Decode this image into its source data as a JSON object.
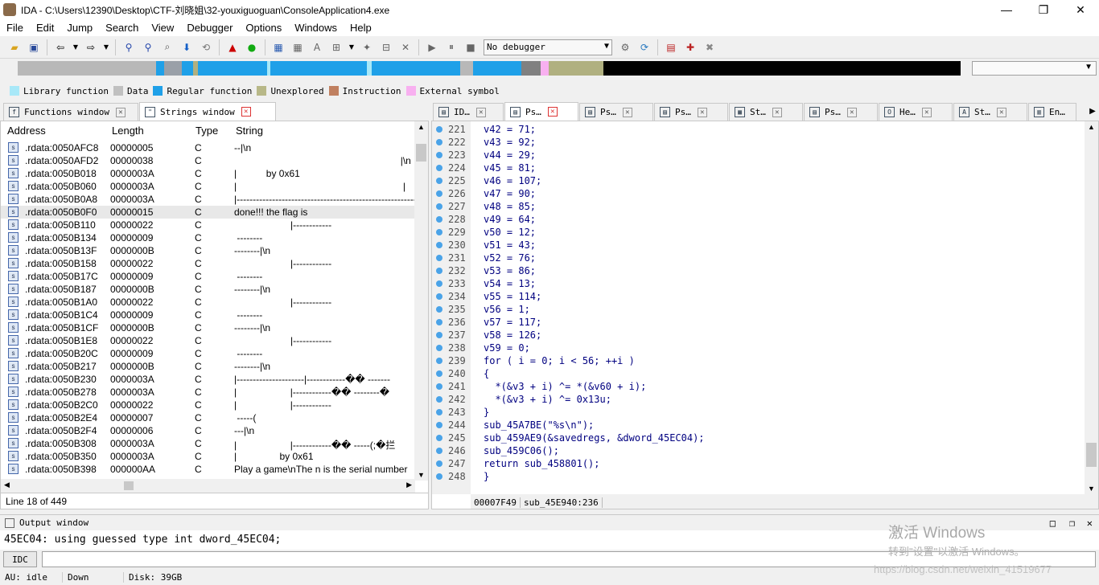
{
  "window": {
    "title": "IDA - C:\\Users\\12390\\Desktop\\CTF-刘晓姐\\32-youxiguoguan\\ConsoleApplication4.exe",
    "minimize": "—",
    "restore": "❐",
    "close": "✕"
  },
  "menu": [
    "File",
    "Edit",
    "Jump",
    "Search",
    "View",
    "Debugger",
    "Options",
    "Windows",
    "Help"
  ],
  "toolbar": {
    "debugger_select": "No debugger"
  },
  "legend": [
    {
      "label": "Library function",
      "color": "#a8e8f8"
    },
    {
      "label": "Data",
      "color": "#c0c0c0"
    },
    {
      "label": "Regular function",
      "color": "#1fa0e8"
    },
    {
      "label": "Unexplored",
      "color": "#b8b888"
    },
    {
      "label": "Instruction",
      "color": "#c08060"
    },
    {
      "label": "External symbol",
      "color": "#f8b0f0"
    }
  ],
  "left_tabs": [
    {
      "label": "Functions window",
      "icon": "f",
      "active": false
    },
    {
      "label": "Strings window",
      "icon": "\"",
      "active": true
    }
  ],
  "right_tabs": [
    {
      "label": "ID…",
      "active": false
    },
    {
      "label": "Ps…",
      "active": true
    },
    {
      "label": "Ps…",
      "active": false
    },
    {
      "label": "Ps…",
      "active": false
    },
    {
      "label": "St…",
      "active": false
    },
    {
      "label": "Ps…",
      "active": false
    },
    {
      "label": "He…",
      "active": false
    },
    {
      "label": "St…",
      "active": false
    },
    {
      "label": "En…",
      "active": false
    }
  ],
  "strings": {
    "columns": [
      "Address",
      "Length",
      "Type",
      "String"
    ],
    "rows": [
      {
        "addr": ".rdata:0050AFC8",
        "len": "00000005",
        "type": "C",
        "str": "--|\\n"
      },
      {
        "addr": ".rdata:0050AFD2",
        "len": "00000038",
        "type": "C",
        "str": "                                                              |\\n"
      },
      {
        "addr": ".rdata:0050B018",
        "len": "0000003A",
        "type": "C",
        "str": "|           by 0x61"
      },
      {
        "addr": ".rdata:0050B060",
        "len": "0000003A",
        "type": "C",
        "str": "|                                                              |"
      },
      {
        "addr": ".rdata:0050B0A8",
        "len": "0000003A",
        "type": "C",
        "str": "|-----------------------------------------------------------"
      },
      {
        "addr": ".rdata:0050B0F0",
        "len": "00000015",
        "type": "C",
        "str": "done!!! the flag is ",
        "selected": true
      },
      {
        "addr": ".rdata:0050B110",
        "len": "00000022",
        "type": "C",
        "str": "                     |------------"
      },
      {
        "addr": ".rdata:0050B134",
        "len": "00000009",
        "type": "C",
        "str": " --------"
      },
      {
        "addr": ".rdata:0050B13F",
        "len": "0000000B",
        "type": "C",
        "str": "--------|\\n"
      },
      {
        "addr": ".rdata:0050B158",
        "len": "00000022",
        "type": "C",
        "str": "                     |------------"
      },
      {
        "addr": ".rdata:0050B17C",
        "len": "00000009",
        "type": "C",
        "str": " --------"
      },
      {
        "addr": ".rdata:0050B187",
        "len": "0000000B",
        "type": "C",
        "str": "--------|\\n"
      },
      {
        "addr": ".rdata:0050B1A0",
        "len": "00000022",
        "type": "C",
        "str": "                     |------------"
      },
      {
        "addr": ".rdata:0050B1C4",
        "len": "00000009",
        "type": "C",
        "str": " --------"
      },
      {
        "addr": ".rdata:0050B1CF",
        "len": "0000000B",
        "type": "C",
        "str": "--------|\\n"
      },
      {
        "addr": ".rdata:0050B1E8",
        "len": "00000022",
        "type": "C",
        "str": "                     |------------"
      },
      {
        "addr": ".rdata:0050B20C",
        "len": "00000009",
        "type": "C",
        "str": " --------"
      },
      {
        "addr": ".rdata:0050B217",
        "len": "0000000B",
        "type": "C",
        "str": "--------|\\n"
      },
      {
        "addr": ".rdata:0050B230",
        "len": "0000003A",
        "type": "C",
        "str": "|---------------------|------------�� -------"
      },
      {
        "addr": ".rdata:0050B278",
        "len": "0000003A",
        "type": "C",
        "str": "|                    |------------�� --------�"
      },
      {
        "addr": ".rdata:0050B2C0",
        "len": "00000022",
        "type": "C",
        "str": "|                    |------------"
      },
      {
        "addr": ".rdata:0050B2E4",
        "len": "00000007",
        "type": "C",
        "str": " -----("
      },
      {
        "addr": ".rdata:0050B2F4",
        "len": "00000006",
        "type": "C",
        "str": "---|\\n"
      },
      {
        "addr": ".rdata:0050B308",
        "len": "0000003A",
        "type": "C",
        "str": "|                    |------------�� -----(;�拦"
      },
      {
        "addr": ".rdata:0050B350",
        "len": "0000003A",
        "type": "C",
        "str": "|                by 0x61"
      },
      {
        "addr": ".rdata:0050B398",
        "len": "000000AA",
        "type": "C",
        "str": "Play a game\\nThe n is the serial number"
      }
    ],
    "status": "Line 18 of 449"
  },
  "pseudocode": {
    "lines": [
      {
        "n": "221",
        "code": "v42 = 71;"
      },
      {
        "n": "222",
        "code": "v43 = 92;"
      },
      {
        "n": "223",
        "code": "v44 = 29;"
      },
      {
        "n": "224",
        "code": "v45 = 81;"
      },
      {
        "n": "225",
        "code": "v46 = 107;"
      },
      {
        "n": "226",
        "code": "v47 = 90;"
      },
      {
        "n": "227",
        "code": "v48 = 85;"
      },
      {
        "n": "228",
        "code": "v49 = 64;"
      },
      {
        "n": "229",
        "code": "v50 = 12;"
      },
      {
        "n": "230",
        "code": "v51 = 43;"
      },
      {
        "n": "231",
        "code": "v52 = 76;"
      },
      {
        "n": "232",
        "code": "v53 = 86;"
      },
      {
        "n": "233",
        "code": "v54 = 13;"
      },
      {
        "n": "234",
        "code": "v55 = 114;"
      },
      {
        "n": "235",
        "code": "v56 = 1;"
      },
      {
        "n": "236",
        "code": "v57 = 117;"
      },
      {
        "n": "237",
        "code": "v58 = 126;"
      },
      {
        "n": "238",
        "code": "v59 = 0;"
      },
      {
        "n": "239",
        "code": "for ( i = 0; i < 56; ++i )"
      },
      {
        "n": "240",
        "code": "{"
      },
      {
        "n": "241",
        "code": "  *(&v3 + i) ^= *(&v60 + i);"
      },
      {
        "n": "242",
        "code": "  *(&v3 + i) ^= 0x13u;"
      },
      {
        "n": "243",
        "code": "}"
      },
      {
        "n": "244",
        "code": "sub_45A7BE(\"%s\\n\");"
      },
      {
        "n": "245",
        "code": "sub_459AE9(&savedregs, &dword_45EC04);"
      },
      {
        "n": "246",
        "code": "sub_459C06();"
      },
      {
        "n": "247",
        "code": "return sub_458801();"
      },
      {
        "n": "248",
        "code": "}"
      }
    ],
    "status_addr": "00007F49",
    "status_func": "sub_45E940:236"
  },
  "output": {
    "title": "Output window",
    "text": "45EC04: using guessed type int dword_45EC04;"
  },
  "idc": {
    "button": "IDC"
  },
  "statusbar": {
    "au": "AU:  idle",
    "dir": "Down",
    "disk": "Disk: 39GB"
  },
  "watermark": {
    "line1": "激活 Windows",
    "line2": "转到\"设置\"以激活 Windows。",
    "line3": "https://blog.csdn.net/weixin_41519677"
  }
}
